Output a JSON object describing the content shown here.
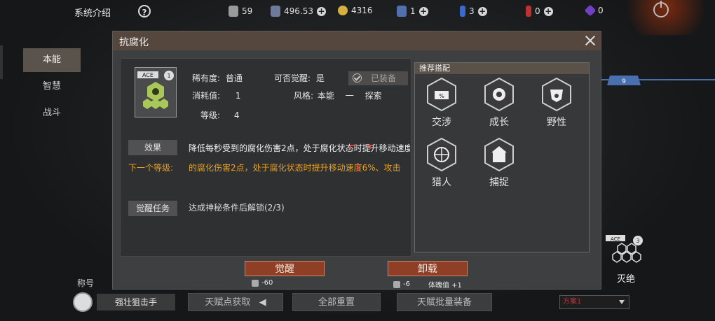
{
  "topbar": {
    "title": "系统介绍",
    "help": "?",
    "resources": [
      {
        "value": "59",
        "color": "#9a9a9a"
      },
      {
        "value": "496.53",
        "color": "#6e7a9a"
      },
      {
        "value": "4316",
        "color": "#d8b040"
      },
      {
        "value": "1",
        "color": "#5070b0"
      },
      {
        "value": "3",
        "color": "#3a6ad0"
      },
      {
        "value": "0",
        "color": "#c03030"
      },
      {
        "value": "0",
        "color": "#7040c0"
      }
    ]
  },
  "sidebar": {
    "items": [
      {
        "label": "本能"
      },
      {
        "label": "智慧"
      },
      {
        "label": "战斗"
      }
    ]
  },
  "dialog": {
    "title": "抗腐化",
    "badge": "ACE",
    "badge_level": "1",
    "rarity_label": "稀有度:",
    "rarity_value": "普通",
    "awaken_label": "可否觉醒:",
    "awaken_value": "是",
    "equipped_label": "已装备",
    "cost_label": "消耗值:",
    "cost_value": "1",
    "style_label": "风格:",
    "style_value1": "本能",
    "style_sep": "一",
    "style_value2": "探索",
    "level_label": "等级:",
    "level_value": "4",
    "effect_label": "效果",
    "effect_text": "降低每秒受到的腐化伤害2点，处于腐化状态时提升移动速度",
    "next_label": "下一个等级:",
    "next_text": "的腐化伤害2点，处于腐化状态时提升移动速度6%、攻击",
    "task_label": "觉醒任务",
    "task_text": "达成神秘条件后解锁(2/3)",
    "recommend": {
      "title": "推荐搭配",
      "traits": [
        {
          "label": "交涉",
          "icon": "negotiation-icon"
        },
        {
          "label": "成长",
          "icon": "growth-icon"
        },
        {
          "label": "野性",
          "icon": "wild-icon"
        },
        {
          "label": "猎人",
          "icon": "hunter-icon"
        },
        {
          "label": "捕捉",
          "icon": "capture-icon"
        }
      ]
    },
    "awaken_btn": "觉醒",
    "awaken_cost": "-60",
    "unload_btn": "卸载",
    "unload_cost": "-6",
    "stamina_text": "体魄值 +1"
  },
  "bottom": {
    "title_label": "称号",
    "title_name": "强壮狙击手",
    "talent_get": "天赋点获取",
    "reset_all": "全部重置",
    "batch_equip": "天赋批量装备",
    "scheme": "方案1"
  },
  "right": {
    "badge": "ACE",
    "badge_level": "3",
    "name": "灭绝",
    "level": "9"
  }
}
